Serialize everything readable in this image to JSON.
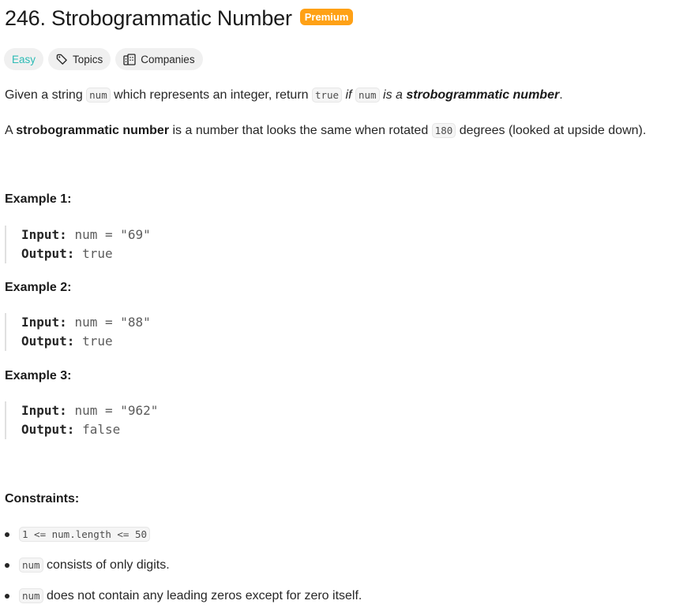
{
  "problem": {
    "title": "246. Strobogrammatic Number",
    "badge": "Premium",
    "tags": {
      "difficulty": "Easy",
      "topics": "Topics",
      "companies": "Companies"
    },
    "description": {
      "p1": {
        "t1": "Given a string ",
        "c1": "num",
        "t2": " which represents an integer, return ",
        "c2": "true",
        "i1": "if",
        "c3": "num",
        "i2": "is a",
        "b1": "strobogrammatic number",
        "t3": "."
      },
      "p2": {
        "t1": "A ",
        "b1": "strobogrammatic number",
        "t2": " is a number that looks the same when rotated ",
        "c1": "180",
        "t3": " degrees (looked at upside down)."
      }
    },
    "examples": [
      {
        "title": "Example 1:",
        "input_label": "Input:",
        "input": "num = \"69\"",
        "output_label": "Output:",
        "output": "true"
      },
      {
        "title": "Example 2:",
        "input_label": "Input:",
        "input": "num = \"88\"",
        "output_label": "Output:",
        "output": "true"
      },
      {
        "title": "Example 3:",
        "input_label": "Input:",
        "input": "num = \"962\"",
        "output_label": "Output:",
        "output": "false"
      }
    ],
    "constraints": {
      "title": "Constraints:",
      "items": [
        {
          "code": "1 <= num.length <= 50",
          "text": ""
        },
        {
          "code": "num",
          "text": " consists of only digits."
        },
        {
          "code": "num",
          "text": " does not contain any leading zeros except for zero itself."
        }
      ]
    }
  }
}
